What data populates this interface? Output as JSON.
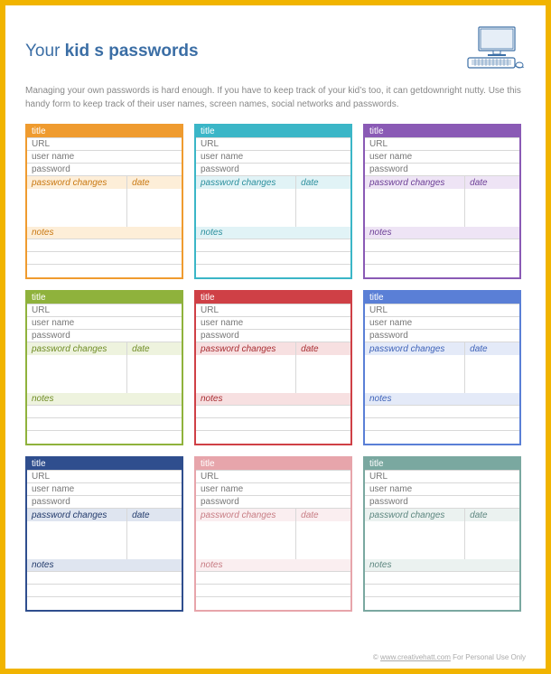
{
  "header": {
    "title_prefix": "Your ",
    "title_bold": "kid s passwords"
  },
  "intro": "Managing your own passwords is hard enough. If you have to keep track of your kid’s too, it can getdownright nutty. Use this handy form to keep track of their user names, screen names, social networks and passwords.",
  "labels": {
    "title": "title",
    "url": "URL",
    "user_name": "user name",
    "password": "password",
    "password_changes": "password changes",
    "date": "date",
    "notes": "notes"
  },
  "cards": [
    {
      "accent": "#ef9b2f",
      "accent_dark": "#c97812",
      "tint": "#fdeed8"
    },
    {
      "accent": "#3bb6c7",
      "accent_dark": "#2b8f9d",
      "tint": "#e1f3f6"
    },
    {
      "accent": "#8a5ab5",
      "accent_dark": "#6c3f96",
      "tint": "#eee4f5"
    },
    {
      "accent": "#8fb23c",
      "accent_dark": "#6f8c25",
      "tint": "#eef3de"
    },
    {
      "accent": "#cf4046",
      "accent_dark": "#a82d32",
      "tint": "#f7e0e1"
    },
    {
      "accent": "#5a7fd6",
      "accent_dark": "#3e62b8",
      "tint": "#e4eaf8"
    },
    {
      "accent": "#2f4e8e",
      "accent_dark": "#223a6b",
      "tint": "#dfe5f0"
    },
    {
      "accent": "#e7a5ab",
      "accent_dark": "#c77c83",
      "tint": "#faeef0"
    },
    {
      "accent": "#7aa8a0",
      "accent_dark": "#5c867f",
      "tint": "#ebf2f0"
    }
  ],
  "footer": {
    "prefix": "© ",
    "link": "www.creativehatt.com",
    "suffix": " For Personal Use Only"
  }
}
